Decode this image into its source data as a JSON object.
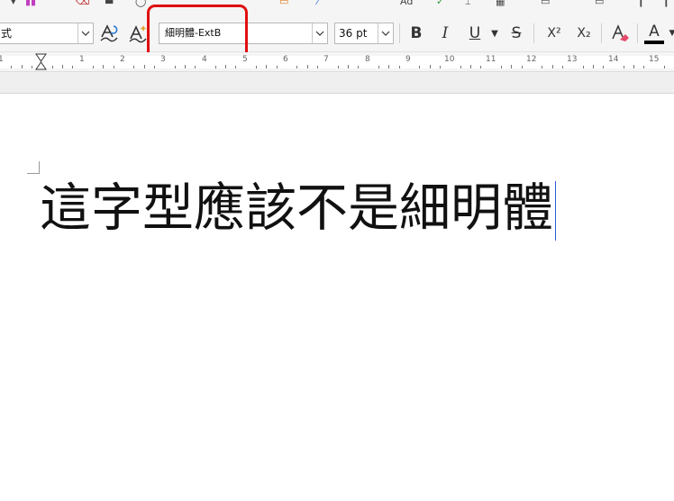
{
  "toolbar": {
    "paragraph_style_value": "式",
    "font_name_value": "細明體-ExtB",
    "font_size_value": "36 pt",
    "bold_label": "B",
    "italic_label": "I",
    "underline_label": "U",
    "strikethrough_label": "S",
    "superscript_label": "X²",
    "subscript_label": "X₂",
    "font_color_label": "A",
    "font_color": "#000000"
  },
  "ruler": {
    "numbers": [
      "1",
      "1",
      "2",
      "3",
      "4",
      "5",
      "6",
      "7",
      "8",
      "9",
      "10",
      "11",
      "12",
      "13",
      "14",
      "15"
    ]
  },
  "document": {
    "text": "這字型應該不是細明體"
  },
  "colors": {
    "highlight": "#e01010",
    "cursor": "#2a5bd0"
  }
}
